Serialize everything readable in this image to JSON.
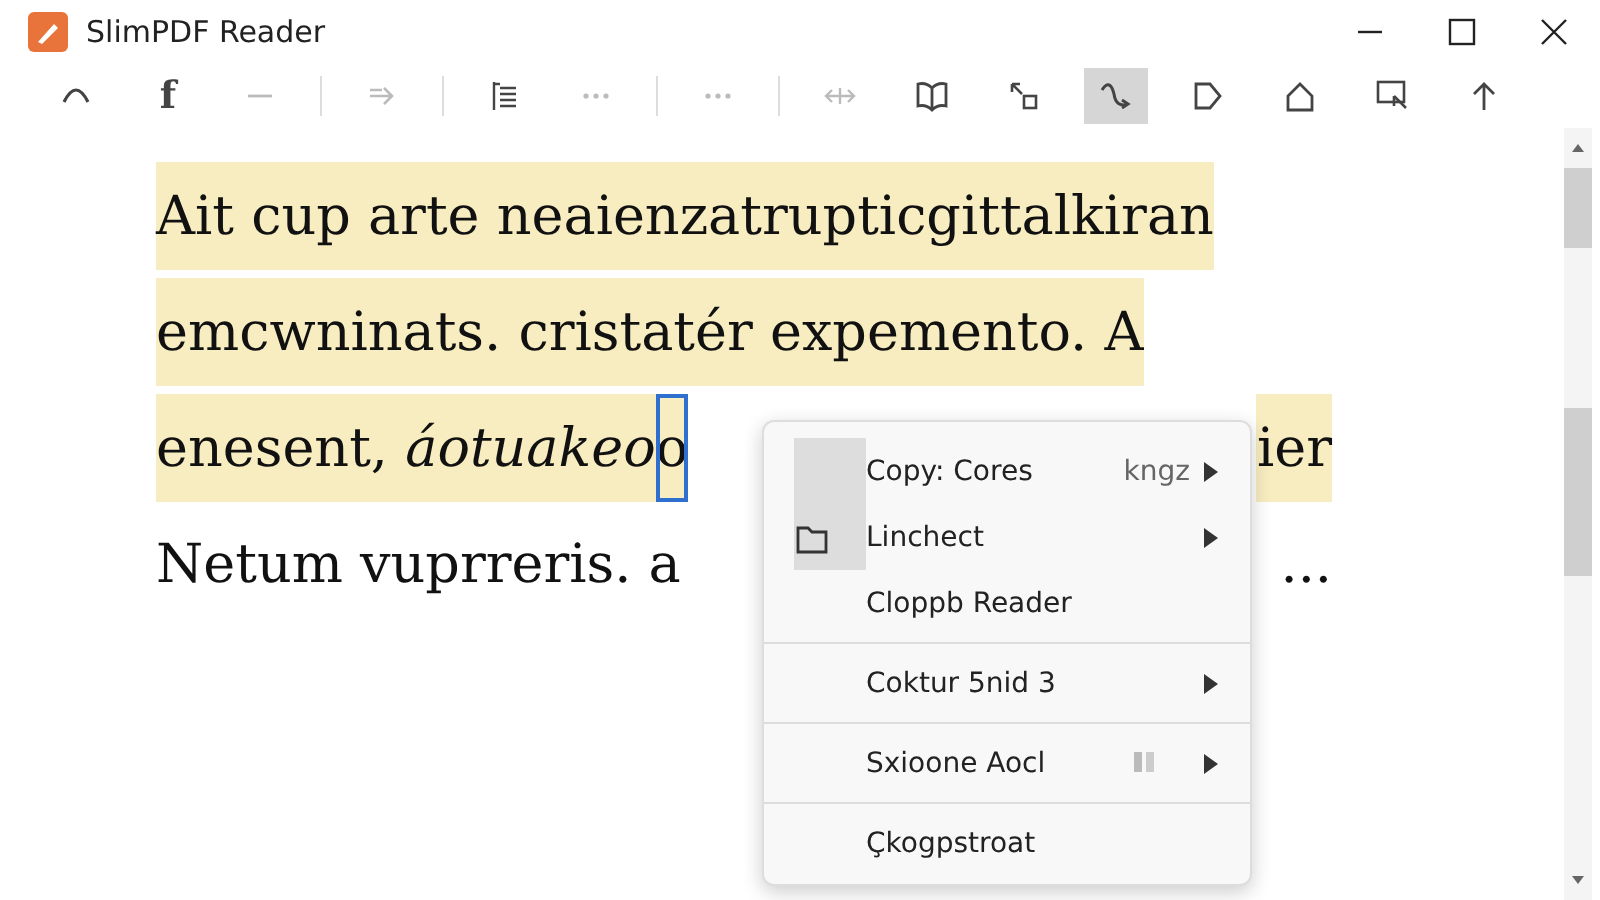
{
  "window": {
    "title": "SlimPDF Reader"
  },
  "toolbar": [
    {
      "kind": "arc",
      "disabled": false,
      "selected": false
    },
    {
      "kind": "letter",
      "label": "f",
      "disabled": false,
      "selected": false
    },
    {
      "kind": "dash",
      "disabled": true,
      "selected": false,
      "divider_after": true
    },
    {
      "kind": "arrow",
      "disabled": true,
      "selected": false,
      "divider_after": true
    },
    {
      "kind": "list",
      "disabled": false,
      "selected": false
    },
    {
      "kind": "dots",
      "disabled": true,
      "selected": false,
      "divider_after": true
    },
    {
      "kind": "dots",
      "disabled": true,
      "selected": false,
      "divider_after": true
    },
    {
      "kind": "move",
      "disabled": true,
      "selected": false
    },
    {
      "kind": "book",
      "disabled": false,
      "selected": false
    },
    {
      "kind": "resize",
      "disabled": false,
      "selected": false
    },
    {
      "kind": "curve",
      "disabled": false,
      "selected": true
    },
    {
      "kind": "tag",
      "disabled": false,
      "selected": false
    },
    {
      "kind": "home",
      "disabled": false,
      "selected": false
    },
    {
      "kind": "screen",
      "disabled": false,
      "selected": false
    },
    {
      "kind": "up",
      "disabled": false,
      "selected": false
    }
  ],
  "document": {
    "lines": [
      {
        "segments": [
          {
            "text": "Ait cup arte neaienzatrupticgittalkiran",
            "highlight": true,
            "kind": "plain"
          }
        ]
      },
      {
        "segments": [
          {
            "text": "emcwninats. cristatér expemento. A",
            "highlight": true,
            "kind": "plain"
          }
        ]
      },
      {
        "segments": [
          {
            "text": "enesent, ",
            "highlight": true,
            "kind": "plain"
          },
          {
            "text": "áotuakeo",
            "highlight": true,
            "kind": "italic"
          },
          {
            "text": "o",
            "highlight": true,
            "kind": "boxed"
          }
        ],
        "trailing": "ier"
      },
      {
        "segments": [
          {
            "text": "Netum vuprreris. a",
            "highlight": false,
            "kind": "plain"
          }
        ],
        "trailing": "..."
      }
    ]
  },
  "context_menu": {
    "groups": [
      [
        {
          "label": "Copy: Cores",
          "shortcut": "kngz",
          "submenu": true,
          "hover": true,
          "kind": "plain",
          "badge_icon": false
        },
        {
          "label": "Linchect",
          "submenu": true,
          "hover": true,
          "kind": "folder",
          "badge_icon": false
        },
        {
          "label": "Cloppb Reader",
          "submenu": false,
          "hover": false,
          "kind": "plain",
          "badge_icon": false
        }
      ],
      [
        {
          "label": "Coktur 5nid 3",
          "submenu": true,
          "hover": false,
          "kind": "plain",
          "badge_icon": false
        }
      ],
      [
        {
          "label": "Sxioone Aocl",
          "submenu": true,
          "hover": false,
          "kind": "plain",
          "badge_icon": true
        }
      ],
      [
        {
          "label": "Çkogpstroat",
          "submenu": false,
          "hover": false,
          "kind": "plain",
          "badge_icon": false
        }
      ]
    ]
  }
}
